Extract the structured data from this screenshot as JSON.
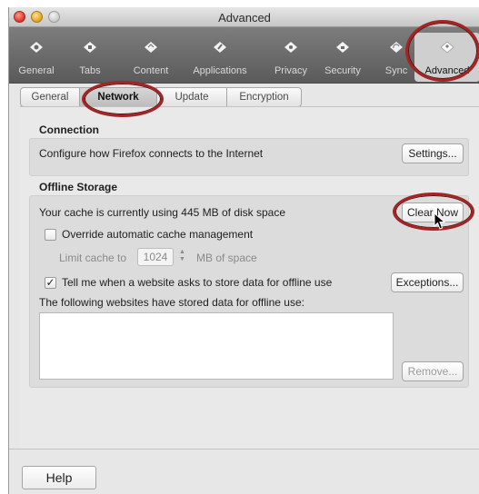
{
  "window": {
    "title": "Advanced"
  },
  "toolbar": {
    "items": [
      {
        "label": "General",
        "icon": "general-icon"
      },
      {
        "label": "Tabs",
        "icon": "tabs-icon"
      },
      {
        "label": "Content",
        "icon": "content-icon"
      },
      {
        "label": "Applications",
        "icon": "applications-icon"
      },
      {
        "label": "Privacy",
        "icon": "privacy-icon"
      },
      {
        "label": "Security",
        "icon": "security-icon"
      },
      {
        "label": "Sync",
        "icon": "sync-icon"
      },
      {
        "label": "Advanced",
        "icon": "advanced-icon",
        "selected": true
      }
    ]
  },
  "tabs": [
    {
      "label": "General"
    },
    {
      "label": "Network",
      "active": true
    },
    {
      "label": "Update"
    },
    {
      "label": "Encryption"
    }
  ],
  "connection": {
    "title": "Connection",
    "description": "Configure how Firefox connects to the Internet",
    "settings_label": "Settings..."
  },
  "offline": {
    "title": "Offline Storage",
    "cache_text": "Your cache is currently using 445 MB of disk space",
    "clear_now_label": "Clear Now",
    "override_label": "Override automatic cache management",
    "override_checked": false,
    "limit_prefix": "Limit cache to",
    "limit_value": "1024",
    "limit_suffix": "MB of space",
    "tell_me_label": "Tell me when a website asks to store data for offline use",
    "tell_me_checked": true,
    "exceptions_label": "Exceptions...",
    "sites_label": "The following websites have stored data for offline use:",
    "remove_label": "Remove..."
  },
  "footer": {
    "help_label": "Help"
  },
  "colors": {
    "annotation": "#a32424",
    "toolbar": "#6b6b6b"
  }
}
